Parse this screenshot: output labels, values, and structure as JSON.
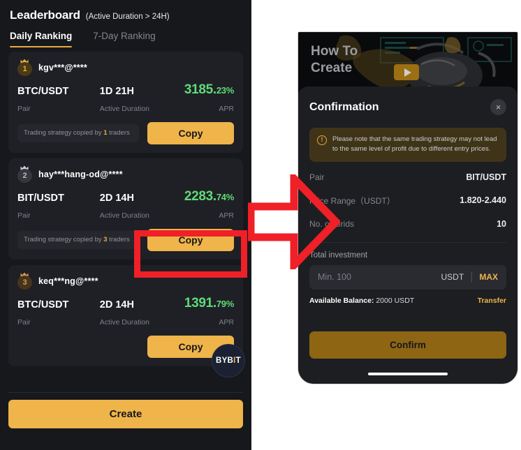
{
  "left_phone": {
    "header": {
      "title": "Leaderboard",
      "subtitle": "(Active Duration > 24H)"
    },
    "tabs": [
      {
        "label": "Daily Ranking",
        "active": true
      },
      {
        "label": "7-Day Ranking",
        "active": false
      }
    ],
    "column_labels": {
      "pair": "Pair",
      "duration": "Active Duration",
      "apr": "APR"
    },
    "cards": [
      {
        "rank": "1",
        "medal": "gold-crown-icon",
        "username": "kgv***@****",
        "pair": "BTC/USDT",
        "duration": "1D 21H",
        "apr_whole": "3185.",
        "apr_dec": "23%",
        "copied_prefix": "Trading strategy copied by ",
        "copied_count": "1",
        "copied_suffix": " traders",
        "copy_label": "Copy"
      },
      {
        "rank": "2",
        "medal": "silver-crown-icon",
        "username": "hay***hang-od@****",
        "pair": "BIT/USDT",
        "duration": "2D 14H",
        "apr_whole": "2283.",
        "apr_dec": "74%",
        "copied_prefix": "Trading strategy copied by ",
        "copied_count": "3",
        "copied_suffix": " traders",
        "copy_label": "Copy"
      },
      {
        "rank": "3",
        "medal": "bronze-crown-icon",
        "username": "keq***ng@****",
        "pair": "BTC/USDT",
        "duration": "2D 14H",
        "apr_whole": "1391.",
        "apr_dec": "79%",
        "copied_prefix": "",
        "copied_count": "",
        "copied_suffix": "",
        "copy_label": "Copy"
      }
    ],
    "create_label": "Create",
    "bybit_badge": {
      "part1": "BYB",
      "dot": "I",
      "part2": "T"
    }
  },
  "right_phone": {
    "video_banner": {
      "line1": "How To",
      "line2": "Create",
      "play": "play-icon"
    },
    "sheet": {
      "title": "Confirmation",
      "close_label": "×",
      "notice": "Please note that the same trading strategy may not lead to the same level of profit due to different entry prices.",
      "rows": [
        {
          "key": "Pair",
          "value": "BIT/USDT"
        },
        {
          "key": "Price Range（USDT）",
          "value": "1.820-2.440"
        },
        {
          "key": "No. of Grids",
          "value": "10"
        }
      ],
      "investment_label": "Total investment",
      "investment_value": "",
      "investment_placeholder": "Min. 100",
      "unit": "USDT",
      "max_label": "MAX",
      "balance_label": "Available Balance:",
      "balance_value": "2000 USDT",
      "transfer_label": "Transfer",
      "confirm_label": "Confirm"
    }
  },
  "annotations": {
    "highlight_box_color": "#ef2027",
    "arrow_color": "#ef2027",
    "arrow_name": "flow-arrow"
  },
  "colors": {
    "accent": "#efb44a",
    "apr_green": "#5fdb78",
    "panel": "#1f2026",
    "background": "#17181c"
  }
}
